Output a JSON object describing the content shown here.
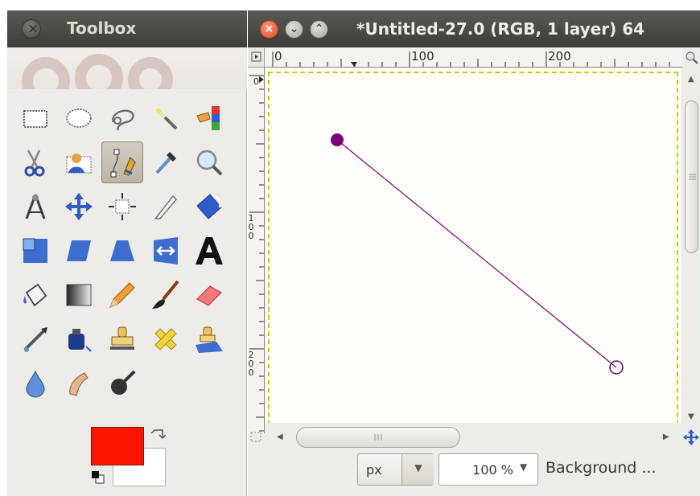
{
  "toolbox": {
    "title": "Toolbox",
    "active_tool": "Paths Tool",
    "tools": [
      [
        "rect-select",
        "ellipse-select",
        "free-select",
        "fuzzy-select",
        "select-by-color"
      ],
      [
        "scissors-select",
        "foreground-select",
        "paths",
        "color-picker",
        "zoom"
      ],
      [
        "measure",
        "move",
        "align",
        "crop",
        "rotate"
      ],
      [
        "scale",
        "shear",
        "perspective",
        "flip",
        "text"
      ],
      [
        "bucket-fill",
        "blend",
        "pencil",
        "paintbrush",
        "eraser"
      ],
      [
        "airbrush",
        "ink",
        "clone",
        "heal",
        "perspective-clone"
      ],
      [
        "blur-sharpen",
        "smudge",
        "dodge-burn"
      ]
    ],
    "foreground_color": "#fa1600",
    "background_color": "#ffffff"
  },
  "image_window": {
    "title": "*Untitled-27.0 (RGB, 1 layer) 64",
    "hruler_labels": [
      "0",
      "100",
      "200"
    ],
    "vruler_labels": [
      "0",
      "1 0 0",
      "2 0 0"
    ],
    "path_color": "#7a007a",
    "statusbar": {
      "unit": "px",
      "zoom": "100 %",
      "layer": "Background ..."
    }
  }
}
